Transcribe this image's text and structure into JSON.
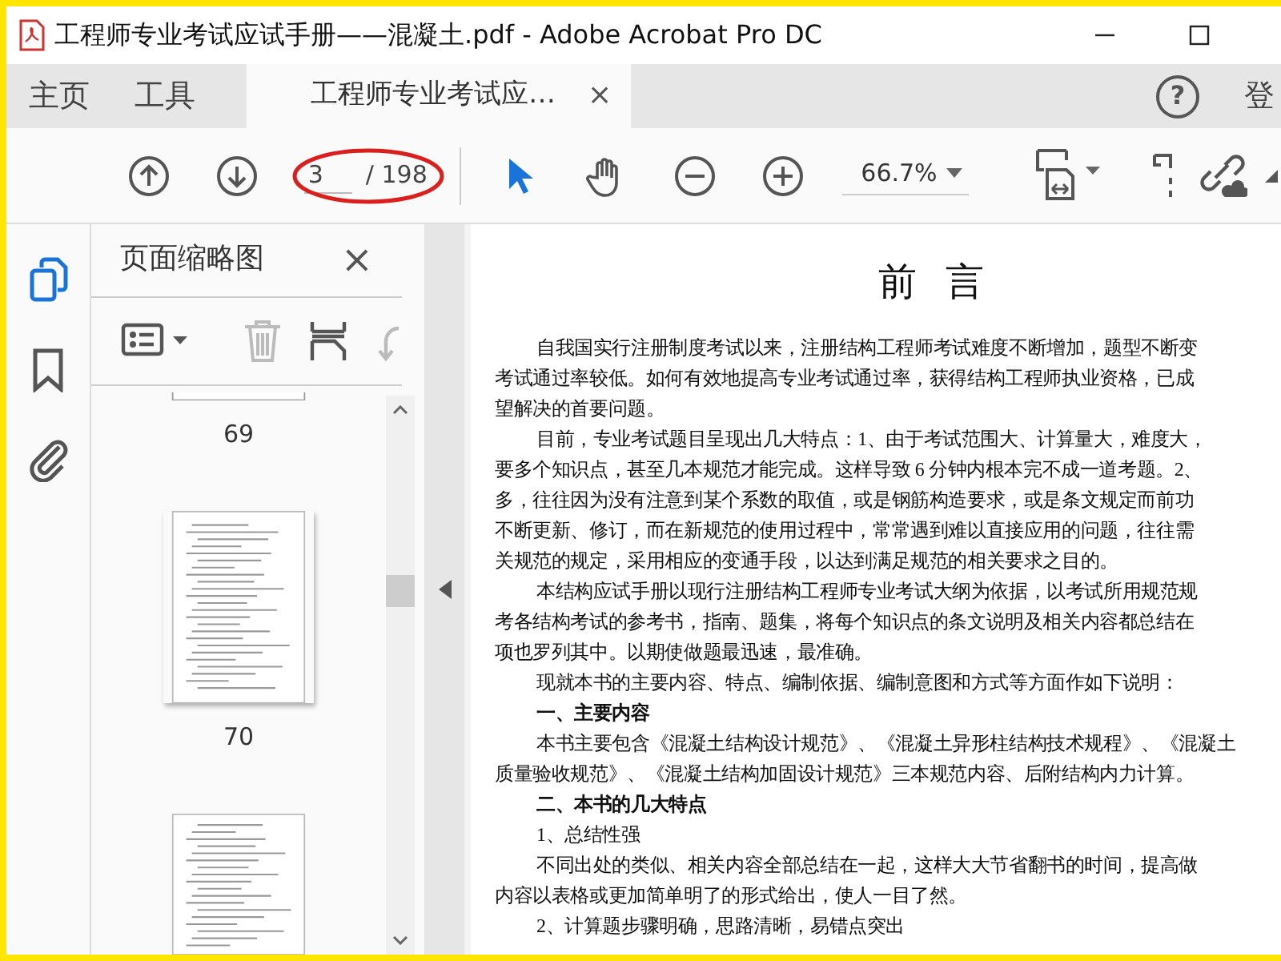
{
  "window": {
    "title": "工程师专业考试应试手册——混凝土.pdf - Adobe Acrobat Pro DC"
  },
  "tabs": [
    {
      "label": "主页",
      "kind": "nav",
      "selected": false
    },
    {
      "label": "工具",
      "kind": "nav",
      "selected": false
    },
    {
      "label": "工程师专业考试应…",
      "kind": "document",
      "selected": true,
      "close": "×"
    }
  ],
  "help": {
    "label": "?"
  },
  "signin": {
    "label": "登"
  },
  "toolbar": {
    "page_current": "3",
    "page_total": "/ 198",
    "zoom": "66.7%",
    "tools": [
      {
        "kind": "select",
        "selected": true
      },
      {
        "kind": "hand",
        "selected": false
      }
    ]
  },
  "sidebar": {
    "items": [
      {
        "kind": "thumbnails",
        "selected": true
      },
      {
        "kind": "bookmarks",
        "selected": false
      },
      {
        "kind": "attachments",
        "selected": false
      }
    ]
  },
  "panel": {
    "title": "页面缩略图",
    "close": "×",
    "actions": [
      {
        "kind": "options",
        "disabled": false
      },
      {
        "kind": "delete",
        "disabled": true
      },
      {
        "kind": "insert",
        "disabled": false
      },
      {
        "kind": "rotate",
        "disabled": true
      }
    ],
    "thumbnails": [
      {
        "kind": "tail",
        "label": "69"
      },
      {
        "kind": "full",
        "label": "70"
      },
      {
        "kind": "head"
      }
    ]
  },
  "document": {
    "title": "前 言",
    "lines": [
      {
        "kind": "first",
        "text": "自我国实行注册制度考试以来，注册结构工程师考试难度不断增加，题型不断变"
      },
      {
        "kind": "cont",
        "text": "考试通过率较低。如何有效地提高专业考试通过率，获得结构工程师执业资格，已成"
      },
      {
        "kind": "cont",
        "text": "望解决的首要问题。"
      },
      {
        "kind": "first",
        "text": "目前，专业考试题目呈现出几大特点：1、由于考试范围大、计算量大，难度大，"
      },
      {
        "kind": "cont",
        "text": "要多个知识点，甚至几本规范才能完成。这样导致 6 分钟内根本完不成一道考题。2、"
      },
      {
        "kind": "cont",
        "text": "多，往往因为没有注意到某个系数的取值，或是钢筋构造要求，或是条文规定而前功"
      },
      {
        "kind": "cont",
        "text": "不断更新、修订，而在新规范的使用过程中，常常遇到难以直接应用的问题，往往需"
      },
      {
        "kind": "cont",
        "text": "关规范的规定，采用相应的变通手段，以达到满足规范的相关要求之目的。"
      },
      {
        "kind": "first",
        "text": "本结构应试手册以现行注册结构工程师专业考试大纲为依据，以考试所用规范规"
      },
      {
        "kind": "cont",
        "text": "考各结构考试的参考书，指南、题集，将每个知识点的条文说明及相关内容都总结在"
      },
      {
        "kind": "cont",
        "text": "项也罗列其中。以期使做题最迅速，最准确。"
      },
      {
        "kind": "first",
        "text": "现就本书的主要内容、特点、编制依据、编制意图和方式等方面作如下说明："
      },
      {
        "kind": "heading",
        "text": "一、主要内容"
      },
      {
        "kind": "first",
        "text": "本书主要包含《混凝土结构设计规范》、《混凝土异形柱结构技术规程》、《混凝土"
      },
      {
        "kind": "cont",
        "text": "质量验收规范》、《混凝土结构加固设计规范》三本规范内容、后附结构内力计算。"
      },
      {
        "kind": "heading",
        "text": "二、本书的几大特点"
      },
      {
        "kind": "first",
        "text": "1、总结性强"
      },
      {
        "kind": "first",
        "text": "不同出处的类似、相关内容全部总结在一起，这样大大节省翻书的时间，提高做"
      },
      {
        "kind": "cont",
        "text": "内容以表格或更加简单明了的形式给出，使人一目了然。"
      },
      {
        "kind": "first",
        "text": "2、计算题步骤明确，思路清晰，易错点突出"
      }
    ]
  }
}
